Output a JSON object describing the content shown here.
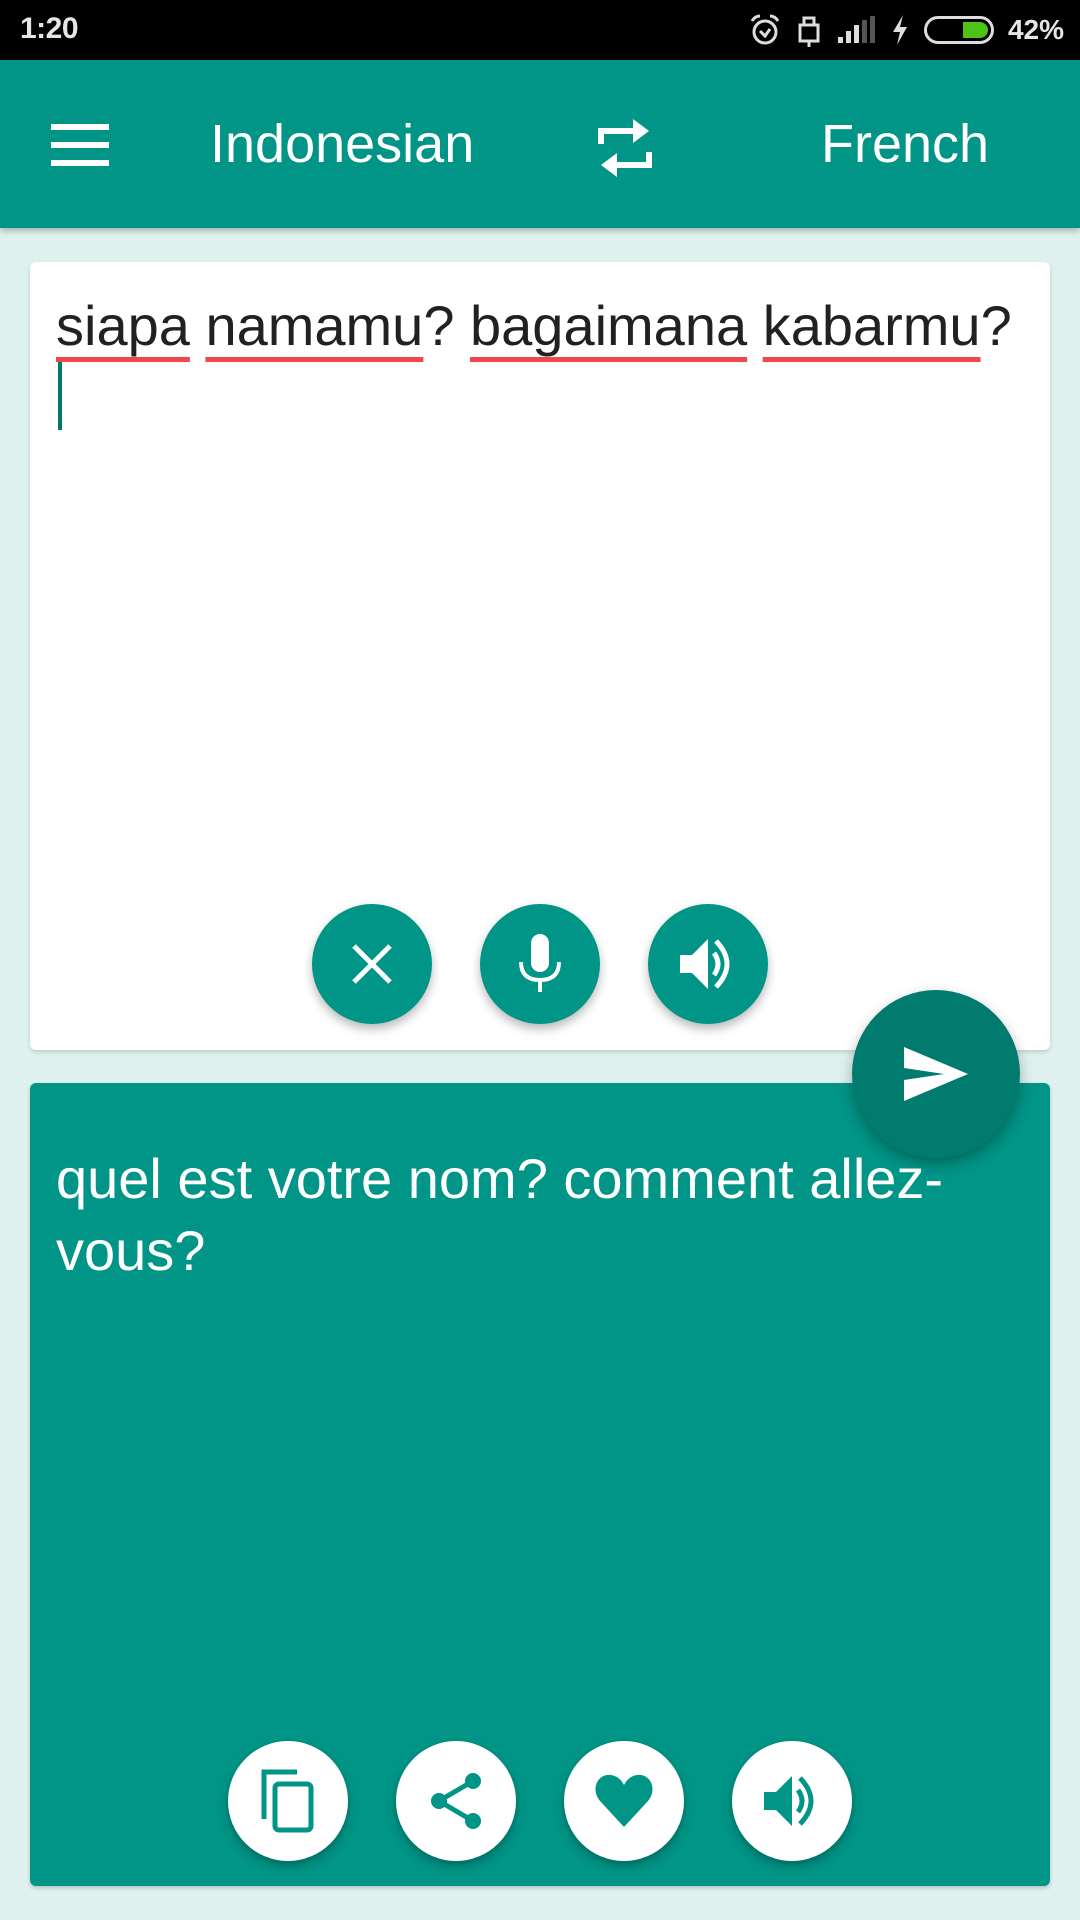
{
  "status_bar": {
    "time": "1:20",
    "battery_percent_label": "42%",
    "battery_level": 0.42,
    "icons": [
      "alarm-icon",
      "lock-icon",
      "signal-icon",
      "charging-icon",
      "battery-icon"
    ],
    "battery_color": "#4cc418"
  },
  "toolbar": {
    "menu_icon": "hamburger-menu-icon",
    "source_language": "Indonesian",
    "swap_icon": "swap-languages-icon",
    "target_language": "French",
    "color": "#009586"
  },
  "input_card": {
    "words": [
      {
        "text": "siapa",
        "misspelled": true
      },
      {
        "text": " ",
        "misspelled": false
      },
      {
        "text": "namamu",
        "misspelled": true
      },
      {
        "text": "? ",
        "misspelled": false
      },
      {
        "text": "bagaimana",
        "misspelled": true
      },
      {
        "text": " ",
        "misspelled": false
      },
      {
        "text": "kabarmu",
        "misspelled": true
      },
      {
        "text": "?",
        "misspelled": false
      }
    ],
    "text": "siapa namamu? bagaimana kabarmu?",
    "buttons": {
      "clear": "close-icon",
      "voice_input": "microphone-icon",
      "speak": "speaker-icon"
    },
    "spellcheck_color": "#f0474d"
  },
  "translate_button": {
    "icon": "send-icon",
    "color": "#007b6e"
  },
  "output_card": {
    "text": "quel est votre nom? comment allez-vous?",
    "buttons": {
      "copy": "copy-icon",
      "share": "share-icon",
      "favorite": "heart-icon",
      "speak": "speaker-icon"
    }
  }
}
